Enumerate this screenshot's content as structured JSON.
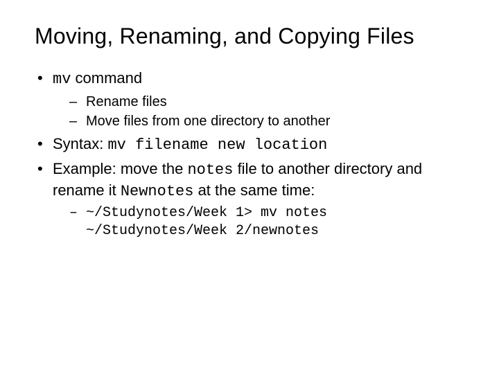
{
  "title": "Moving, Renaming, and Copying Files",
  "b1": {
    "code": "mv",
    "rest": " command"
  },
  "s1": "Rename files",
  "s2": "Move files from one directory to another",
  "b2": {
    "pre": "Syntax: ",
    "code": "mv filename new location"
  },
  "b3": {
    "pre": "Example: move the ",
    "code1": "notes",
    "mid": " file to another directory and rename it ",
    "code2": "Newnotes",
    "post": " at the same time:"
  },
  "s3": {
    "l1": "~/Studynotes/Week 1> mv notes",
    "l2": "~/Studynotes/Week 2/newnotes"
  }
}
